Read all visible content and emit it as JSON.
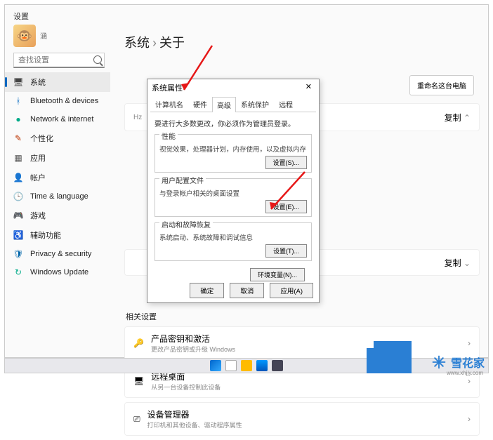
{
  "window": {
    "title": "设置",
    "username": "涵"
  },
  "search": {
    "placeholder": "查找设置"
  },
  "sidebar": {
    "items": [
      {
        "label": "系统",
        "icon": "🖥",
        "color": "#444"
      },
      {
        "label": "Bluetooth & devices",
        "icon": "ᚼ",
        "color": "#0067c0"
      },
      {
        "label": "Network & internet",
        "icon": "●",
        "color": "#0a8"
      },
      {
        "label": "个性化",
        "icon": "✎",
        "color": "#b30"
      },
      {
        "label": "应用",
        "icon": "▦",
        "color": "#555"
      },
      {
        "label": "帐户",
        "icon": "👤",
        "color": "#37b"
      },
      {
        "label": "Time & language",
        "icon": "🕒",
        "color": "#c60"
      },
      {
        "label": "游戏",
        "icon": "🎮",
        "color": "#3ac"
      },
      {
        "label": "辅助功能",
        "icon": "♿",
        "color": "#06a"
      },
      {
        "label": "Privacy & security",
        "icon": "🛡",
        "color": "#06a"
      },
      {
        "label": "Windows Update",
        "icon": "↻",
        "color": "#0a8"
      }
    ]
  },
  "breadcrumb": {
    "root": "系统",
    "current": "关于"
  },
  "actions": {
    "rename": "重命名这台电脑"
  },
  "cards": {
    "copy": "复制",
    "hz": "Hz",
    "related_title": "相关设置",
    "related": [
      {
        "title": "产品密钥和激活",
        "sub": "更改产品密钥或升级 Windows",
        "icon": "🔑"
      },
      {
        "title": "远程桌面",
        "sub": "从另一台设备控制此设备",
        "icon": "🖥"
      },
      {
        "title": "设备管理器",
        "sub": "打印机和其他设备、驱动程序属性",
        "icon": "⎚"
      }
    ]
  },
  "dialog": {
    "title": "系统属性",
    "tabs": [
      "计算机名",
      "硬件",
      "高级",
      "系统保护",
      "远程"
    ],
    "active_tab": 2,
    "note": "要进行大多数更改，你必须作为管理员登录。",
    "groups": [
      {
        "title": "性能",
        "body": "视觉效果，处理器计划，内存使用，以及虚拟内存",
        "button": "设置(S)..."
      },
      {
        "title": "用户配置文件",
        "body": "与登录帐户相关的桌面设置",
        "button": "设置(E)..."
      },
      {
        "title": "启动和故障恢复",
        "body": "系统启动、系统故障和调试信息",
        "button": "设置(T)..."
      }
    ],
    "env": "环境变量(N)...",
    "buttons": {
      "ok": "确定",
      "cancel": "取消",
      "apply": "应用(A)"
    },
    "close": "✕"
  },
  "watermark": {
    "text": "雪花家",
    "url": "www.xhjjy.com"
  }
}
